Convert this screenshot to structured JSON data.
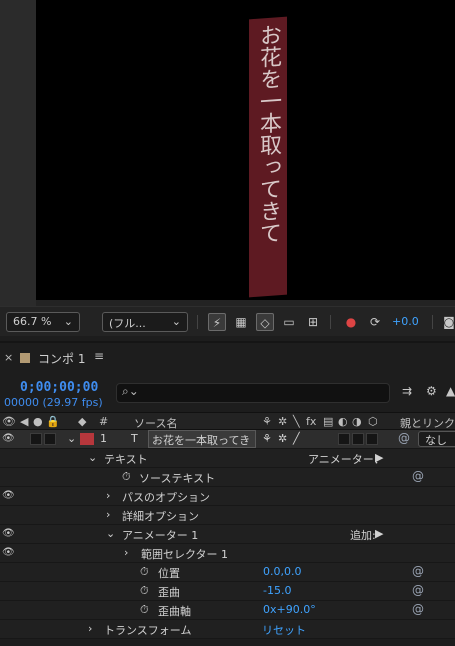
{
  "viewer": {
    "text_layer": "お花を一本取ってきて",
    "zoom_label": "66.7 %",
    "resolution_label": "(フル...",
    "exposure_value": "+0.0"
  },
  "panel": {
    "close_label": "×",
    "tab_title": "コンポ 1",
    "menu_label": "≡"
  },
  "time": {
    "timecode": "0;00;00;00",
    "fps_label": "00000 (29.97 fps)"
  },
  "columns": {
    "layer_number": "#",
    "source_name": "ソース名",
    "parent": "親とリンク"
  },
  "layer": {
    "number": "1",
    "type_icon": "T",
    "name": "お花を一本取ってきて",
    "parent_value": "なし",
    "color": "#b7373c"
  },
  "tree": {
    "text_group": "テキスト",
    "animator_menu": "アニメーター：",
    "source_text": "ソーステキスト",
    "path_options": "パスのオプション",
    "more_options": "詳細オプション",
    "animator": "アニメーター 1",
    "add_menu": "追加:",
    "range_selector": "範囲セレクター 1",
    "position_label": "位置",
    "position_value": "0.0,0.0",
    "skew_label": "歪曲",
    "skew_value": "-15.0",
    "skew_axis_label": "歪曲軸",
    "skew_axis_value": "0x+90.0°",
    "transform": "トランスフォーム",
    "reset": "リセット"
  }
}
